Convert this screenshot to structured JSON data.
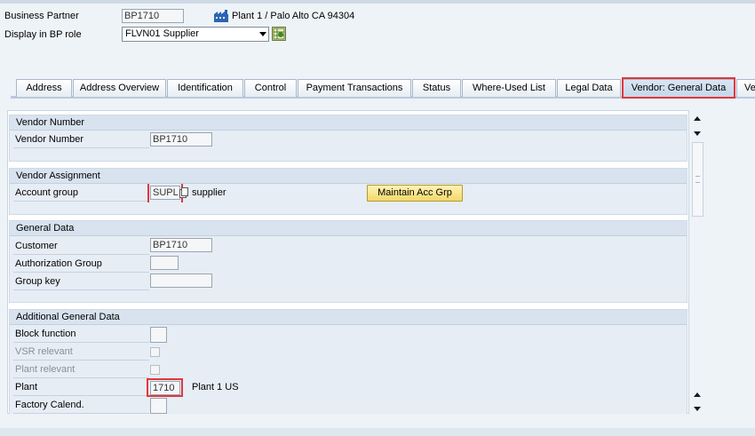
{
  "header": {
    "business_partner_label": "Business Partner",
    "business_partner_value": "BP1710",
    "plant_address": "Plant 1 / Palo Alto CA 94304",
    "bp_role_label": "Display in BP role",
    "bp_role_value": "FLVN01 Supplier"
  },
  "tabs": [
    {
      "label": "Address"
    },
    {
      "label": "Address Overview"
    },
    {
      "label": "Identification"
    },
    {
      "label": "Control"
    },
    {
      "label": "Payment Transactions"
    },
    {
      "label": "Status"
    },
    {
      "label": "Where-Used List"
    },
    {
      "label": "Legal Data"
    },
    {
      "label": "Vendor: General Data",
      "active": true
    },
    {
      "label": "Ve"
    }
  ],
  "vendor_number": {
    "title": "Vendor Number",
    "label": "Vendor Number",
    "value": "BP1710"
  },
  "vendor_assignment": {
    "title": "Vendor Assignment",
    "account_group_label": "Account group",
    "account_group_value": "SUPL",
    "account_group_desc": "supplier",
    "maintain_button": "Maintain Acc Grp"
  },
  "general_data": {
    "title": "General Data",
    "customer_label": "Customer",
    "customer_value": "BP1710",
    "auth_group_label": "Authorization Group",
    "auth_group_value": "",
    "group_key_label": "Group key",
    "group_key_value": ""
  },
  "additional": {
    "title": "Additional General Data",
    "block_function_label": "Block function",
    "vsr_label": "VSR relevant",
    "plant_relevant_label": "Plant relevant",
    "plant_label": "Plant",
    "plant_value": "1710",
    "plant_desc": "Plant 1 US",
    "factory_label": "Factory Calend."
  },
  "colors": {
    "highlight": "#e0383e",
    "button_yellow": "#f3d96a"
  }
}
